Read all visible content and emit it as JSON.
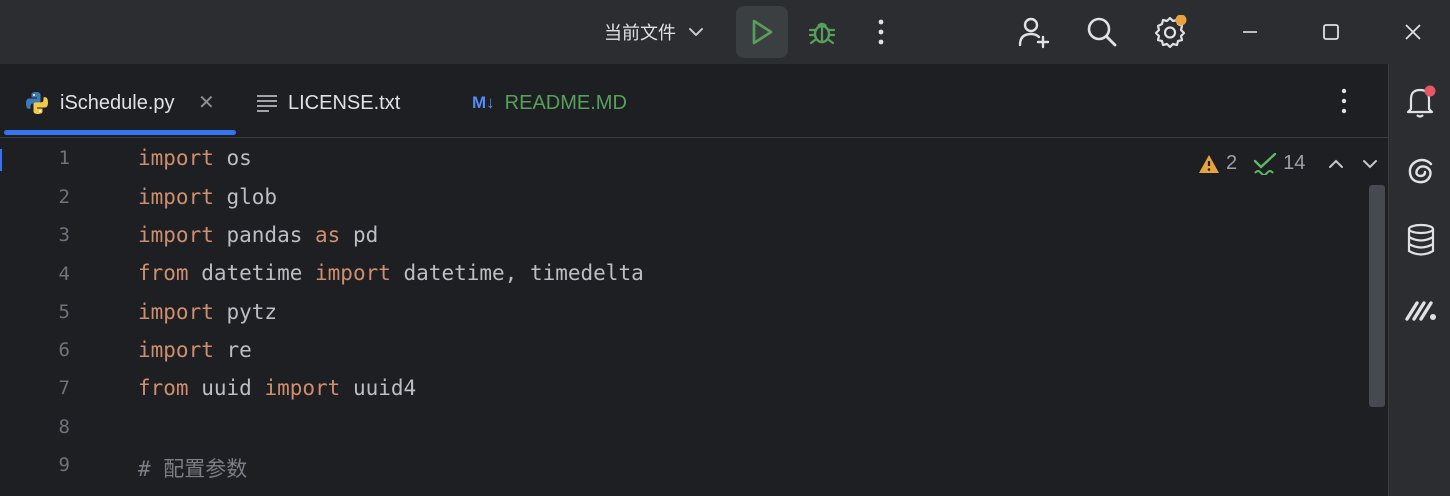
{
  "titlebar": {
    "run_config": "当前文件",
    "run_icon": "play-icon",
    "debug_icon": "bug-icon",
    "more_icon": "kebab-icon",
    "add_user_icon": "add-user-icon",
    "search_icon": "search-icon",
    "settings_icon": "gear-icon",
    "settings_badge_color": "#e8a33d"
  },
  "tabs": [
    {
      "label": "iSchedule.py",
      "icon": "python-icon",
      "active": true
    },
    {
      "label": "LICENSE.txt",
      "icon": "text-lines-icon",
      "active": false
    },
    {
      "label": "README.MD",
      "icon": "markdown-icon",
      "icon_text": "M↓",
      "active": false
    }
  ],
  "inspections": {
    "warnings": "2",
    "weak_warnings": "14"
  },
  "gutter": [
    "1",
    "2",
    "3",
    "4",
    "5",
    "6",
    "7",
    "8",
    "9"
  ],
  "code": {
    "l1_kw": "import",
    "l1_rest": " os",
    "l2_kw": "import",
    "l2_rest": " glob",
    "l3_kw": "import",
    "l3_mid": " pandas ",
    "l3_kw2": "as",
    "l3_rest": " pd",
    "l4_kw": "from",
    "l4_mid": " datetime ",
    "l4_kw2": "import",
    "l4_rest": " datetime, timedelta",
    "l5_kw": "import",
    "l5_rest": " pytz",
    "l6_kw": "import",
    "l6_rest": " re",
    "l7_kw": "from",
    "l7_mid": " uuid ",
    "l7_kw2": "import",
    "l7_rest": " uuid4",
    "l9_comment": "# 配置参数"
  },
  "colors": {
    "keyword": "#cf8e6d",
    "accent": "#3574f0",
    "run_green": "#57a05b",
    "notification_dot": "#e55765"
  },
  "right_strip": [
    "notifications-icon",
    "ai-assistant-icon",
    "database-icon",
    "markdown-preview-icon"
  ]
}
